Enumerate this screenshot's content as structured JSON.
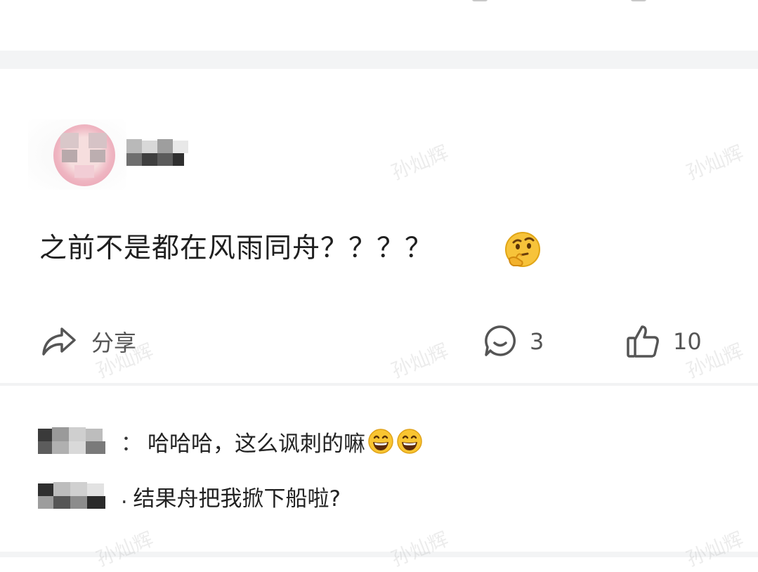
{
  "post": {
    "text": "之前不是都在风雨同舟？？？？"
  },
  "actions": {
    "share_label": "分享",
    "comment_count": "3",
    "like_count": "10"
  },
  "replies": [
    {
      "colon": "：",
      "text": "哈哈哈，这么讽刺的嘛"
    },
    {
      "colon": ".",
      "text": "结果舟把我掀下船啦?"
    }
  ],
  "watermark": "孙灿辉",
  "icons": {
    "share": "share-arrow-icon",
    "comment": "comment-bubble-icon",
    "like": "thumbs-up-icon",
    "post_emoji": "thinking-face-emoji",
    "reply_emoji": "grinning-face-emoji"
  },
  "colors": {
    "separator": "#f3f4f5",
    "text": "#1f1f1f",
    "icon": "#555555"
  }
}
